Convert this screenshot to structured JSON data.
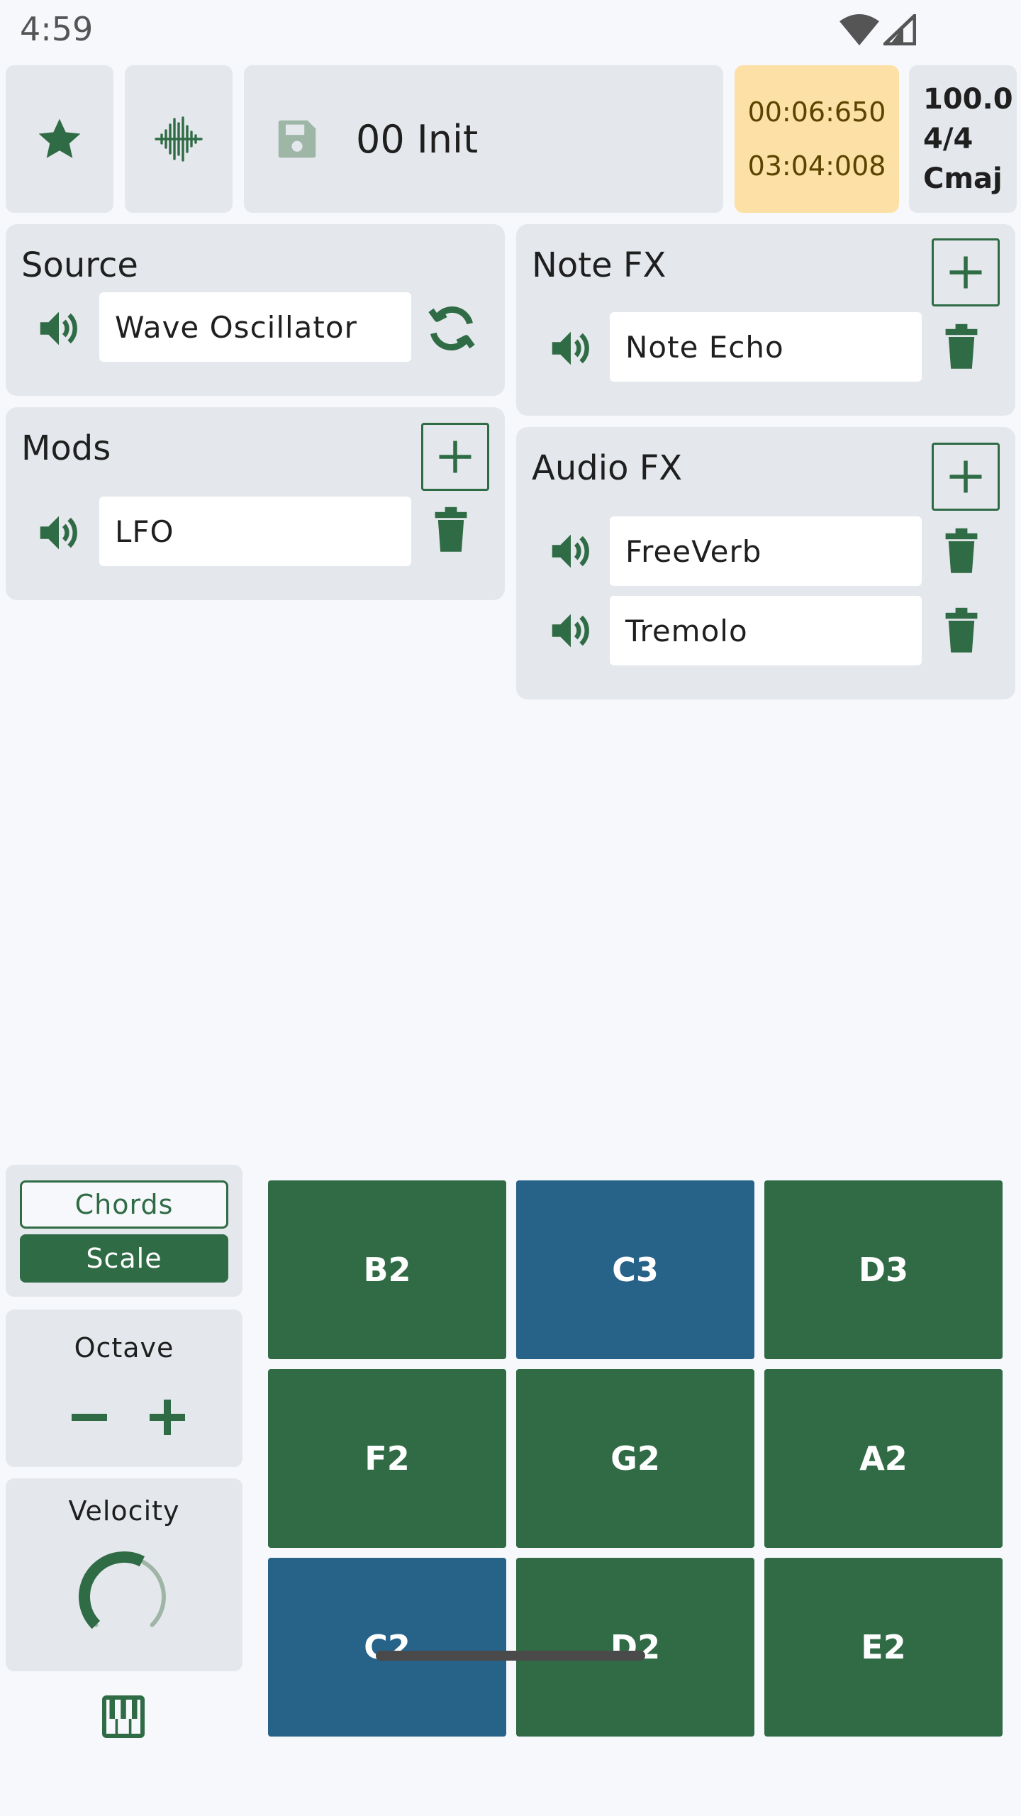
{
  "status": {
    "time": "4:59"
  },
  "toolbar": {
    "preset_name": "00 Init",
    "timer_position": "00:06:650",
    "timer_length": "03:04:008",
    "tempo": "100.0",
    "time_signature": "4/4",
    "key": "Cmaj",
    "icons": [
      "star-icon",
      "waveform-icon",
      "save-icon"
    ]
  },
  "source": {
    "title": "Source",
    "value": "Wave Oscillator"
  },
  "mods": {
    "title": "Mods",
    "items": [
      {
        "value": "LFO"
      }
    ]
  },
  "note_fx": {
    "title": "Note FX",
    "items": [
      {
        "value": "Note Echo"
      }
    ]
  },
  "audio_fx": {
    "title": "Audio FX",
    "items": [
      {
        "value": "FreeVerb"
      },
      {
        "value": "Tremolo"
      }
    ]
  },
  "keyboard": {
    "mode_chords": "Chords",
    "mode_scale": "Scale",
    "selected_mode": "Scale",
    "octave_label": "Octave",
    "velocity_label": "Velocity",
    "velocity_level": 0.6,
    "pads": [
      [
        {
          "note": "B2",
          "root": false
        },
        {
          "note": "C3",
          "root": true
        },
        {
          "note": "D3",
          "root": false
        }
      ],
      [
        {
          "note": "F2",
          "root": false
        },
        {
          "note": "G2",
          "root": false
        },
        {
          "note": "A2",
          "root": false
        }
      ],
      [
        {
          "note": "C2",
          "root": true
        },
        {
          "note": "D2",
          "root": false
        },
        {
          "note": "E2",
          "root": false
        }
      ]
    ]
  },
  "colors": {
    "accent": "#2f6b45",
    "root_pad": "#276389",
    "pad": "#316b45",
    "timer_bg": "#fde0a6",
    "panel": "#e4e7eb"
  }
}
